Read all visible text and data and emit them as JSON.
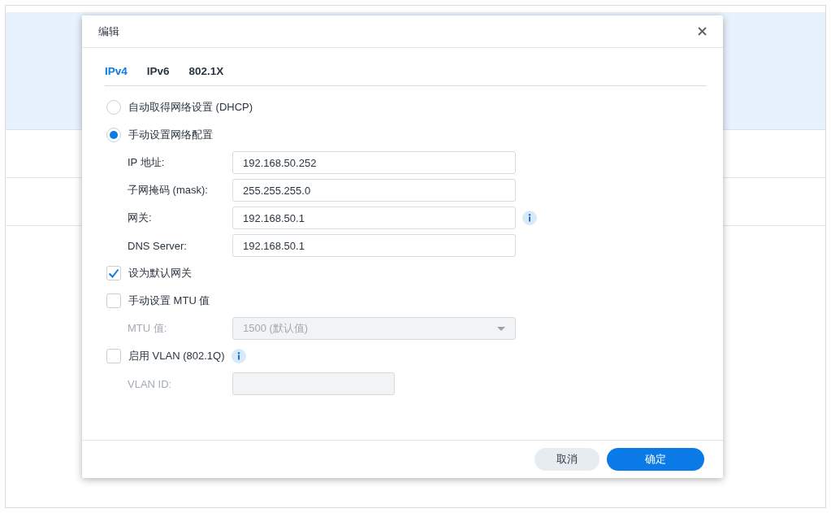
{
  "dialog": {
    "title": "编辑",
    "tabs": [
      {
        "label": "IPv4",
        "selected": true
      },
      {
        "label": "IPv6",
        "selected": false
      },
      {
        "label": "802.1X",
        "selected": false
      }
    ],
    "rows": [
      {
        "kind": "radio",
        "label": "自动取得网络设置 (DHCP)",
        "selected": false
      },
      {
        "kind": "radio",
        "label": "手动设置网络配置",
        "selected": true
      },
      {
        "kind": "field",
        "label": "IP 地址:",
        "value": "192.168.50.252",
        "disabled": false
      },
      {
        "kind": "field",
        "label": "子网掩码 (mask):",
        "value": "255.255.255.0",
        "disabled": false
      },
      {
        "kind": "field",
        "label": "网关:",
        "value": "192.168.50.1",
        "disabled": false,
        "info": true
      },
      {
        "kind": "field",
        "label": "DNS Server:",
        "value": "192.168.50.1",
        "disabled": false
      },
      {
        "kind": "checkbox",
        "label": "设为默认网关",
        "checked": true
      },
      {
        "kind": "checkbox",
        "label": "手动设置 MTU 值",
        "checked": false
      },
      {
        "kind": "select",
        "label": "MTU 值:",
        "value": "1500 (默认值)",
        "disabled": true
      },
      {
        "kind": "checkbox",
        "label": "启用 VLAN (802.1Q)",
        "checked": false,
        "info": true
      },
      {
        "kind": "short_field",
        "label": "VLAN ID:",
        "disabled": true
      }
    ],
    "buttons": [
      {
        "label": "取消",
        "kind": "secondary"
      },
      {
        "label": "确定",
        "kind": "primary"
      }
    ]
  }
}
